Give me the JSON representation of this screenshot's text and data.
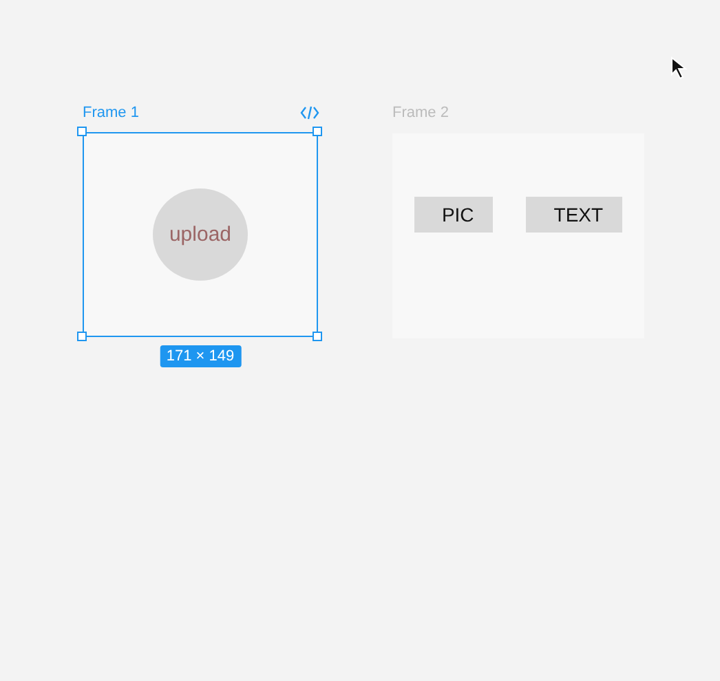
{
  "frames": [
    {
      "label": "Frame 1",
      "selected": true,
      "size": "171 × 149",
      "elements": [
        {
          "kind": "circle",
          "text": "upload"
        }
      ]
    },
    {
      "label": "Frame 2",
      "selected": false,
      "elements": [
        {
          "kind": "rect",
          "text": "PIC"
        },
        {
          "kind": "rect",
          "text": "TEXT"
        }
      ]
    }
  ]
}
